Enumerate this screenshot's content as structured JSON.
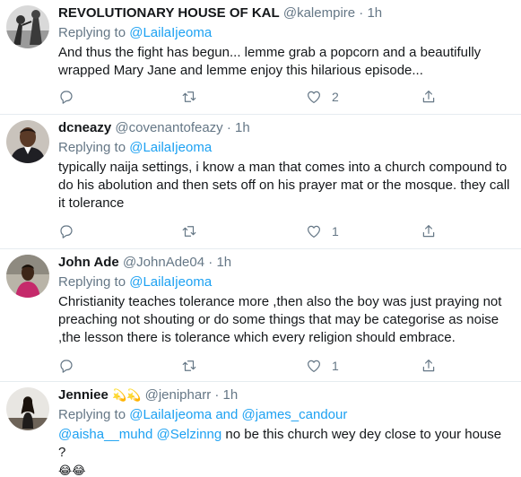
{
  "tweets": [
    {
      "name": "REVOLUTIONARY HOUSE OF KAL",
      "handle": "@kalempire",
      "time": "1h",
      "replying_prefix": "Replying to",
      "replying_to": "@LailaIjeoma",
      "text": "And thus the fight has begun... lemme grab a popcorn and a beautifully wrapped Mary Jane and lemme enjoy this hilarious episode...",
      "retweets": "",
      "likes": "2"
    },
    {
      "name": "dcneazy",
      "handle": "@covenantofeazy",
      "time": "1h",
      "replying_prefix": "Replying to",
      "replying_to": "@LailaIjeoma",
      "text": "typically naija settings, i know a man that comes into a church compound to do his abolution and then sets off on his prayer mat or the mosque. they call it tolerance",
      "retweets": "",
      "likes": "1"
    },
    {
      "name": "John Ade",
      "handle": "@JohnAde04",
      "time": "1h",
      "replying_prefix": "Replying to",
      "replying_to": "@LailaIjeoma",
      "text": "Christianity teaches tolerance more ,then also the boy was just praying not preaching not shouting or do some things that may be categorise as noise ,the lesson there is tolerance which every religion should embrace.",
      "retweets": "",
      "likes": "1"
    },
    {
      "name": "Jenniee",
      "name_emoji": "💫💫",
      "handle": "@jenipharr",
      "time": "1h",
      "replying_prefix": "Replying to",
      "replying_to": "@LailaIjeoma",
      "replying_and": "and",
      "replying_to_2": "@james_candour",
      "mention_1": "@aisha__muhd",
      "mention_2": "@Selzinng",
      "text": "no be this church wey dey close to your house ?",
      "text_emoji": "😂😂"
    }
  ],
  "dot": "·",
  "icons": [
    "reply-icon",
    "retweet-icon",
    "like-icon",
    "share-icon"
  ],
  "colors": {
    "link": "#1da1f2",
    "secondary": "#657786",
    "divider": "#e6ecf0"
  }
}
